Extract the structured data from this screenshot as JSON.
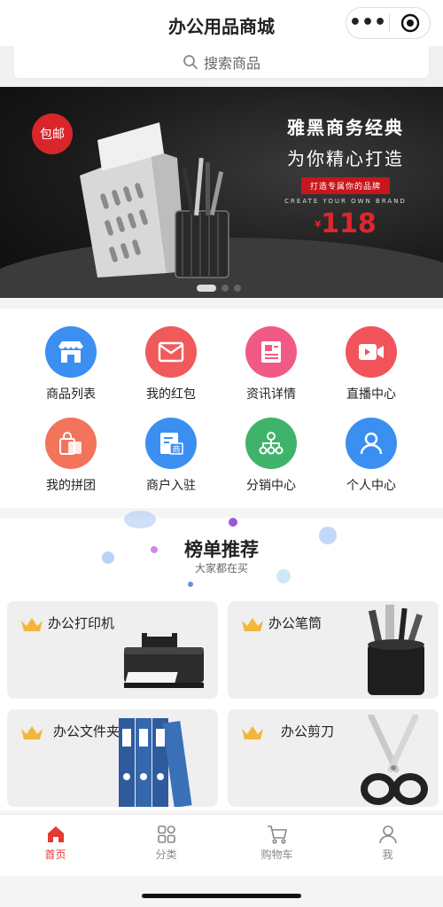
{
  "app": {
    "title": "办公用品商城"
  },
  "search": {
    "placeholder": "搜索商品"
  },
  "banner": {
    "badge": "包邮",
    "line1": "雅黑商务经典",
    "line2": "为你精心打造",
    "tagline": "打造专属你的品牌",
    "english": "CREATE YOUR OWN BRAND",
    "currency": "¥",
    "price": "118"
  },
  "menu": [
    {
      "label": "商品列表",
      "icon": "store-icon",
      "color": "#3b8ff0"
    },
    {
      "label": "我的红包",
      "icon": "envelope-icon",
      "color": "#f05a5a"
    },
    {
      "label": "资讯详情",
      "icon": "document-icon",
      "color": "#f25a86"
    },
    {
      "label": "直播中心",
      "icon": "video-camera-icon",
      "color": "#f2545b"
    },
    {
      "label": "我的拼团",
      "icon": "shopping-bag-icon",
      "color": "#f3735b"
    },
    {
      "label": "商户入驻",
      "icon": "merchant-icon",
      "color": "#3b8ff0"
    },
    {
      "label": "分销中心",
      "icon": "network-icon",
      "color": "#3fb36a"
    },
    {
      "label": "个人中心",
      "icon": "user-icon",
      "color": "#3b8ff0"
    }
  ],
  "ranking": {
    "title": "榜单推荐",
    "subtitle": "大家都在买",
    "items": [
      {
        "name": "办公打印机",
        "image": "printer"
      },
      {
        "name": "办公笔筒",
        "image": "pen-holder"
      },
      {
        "name": "办公文件夹",
        "image": "binders"
      },
      {
        "name": "办公剪刀",
        "image": "scissors"
      }
    ]
  },
  "tabbar": [
    {
      "label": "首页",
      "icon": "home-icon",
      "active": true
    },
    {
      "label": "分类",
      "icon": "category-icon",
      "active": false
    },
    {
      "label": "购物车",
      "icon": "cart-icon",
      "active": false
    },
    {
      "label": "我",
      "icon": "profile-icon",
      "active": false
    }
  ],
  "colors": {
    "accent": "#e53935",
    "banner_red": "#c8161d",
    "crown": "#f3b63a"
  }
}
